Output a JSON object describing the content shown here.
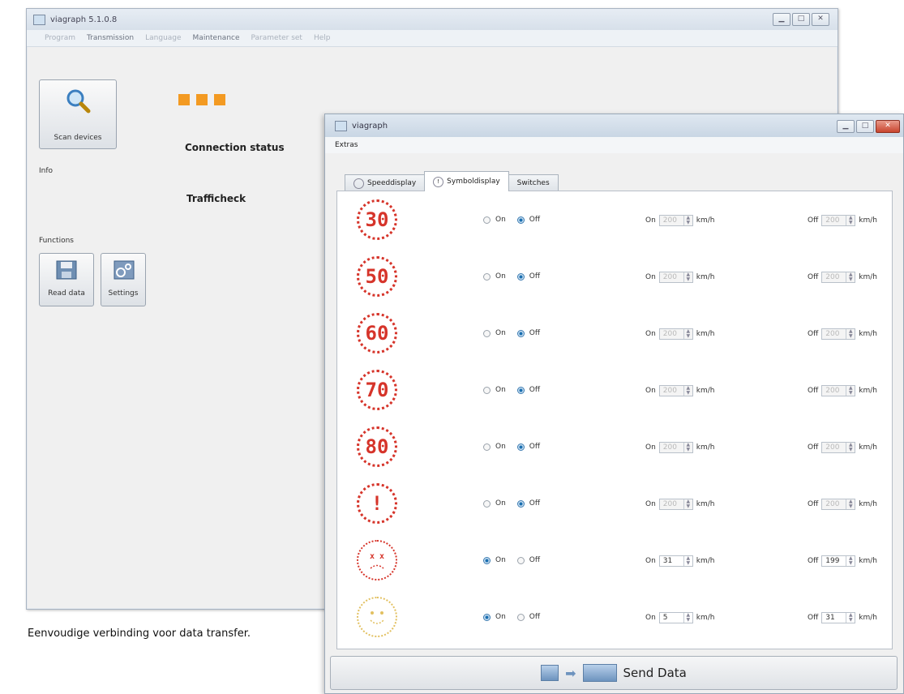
{
  "back_window": {
    "title": "viagraph 5.1.0.8",
    "menu": [
      "Program",
      "Transmission",
      "Language",
      "Maintenance",
      "Parameter set",
      "Help"
    ],
    "scan_label": "Scan devices",
    "connection_status_label": "Connection status",
    "info_label": "Info",
    "device_name": "Trafficheck",
    "functions_label": "Functions",
    "read_data_label": "Read data",
    "settings_label": "Settings",
    "led_color": "#f39a22"
  },
  "caption": "Eenvoudige verbinding voor data transfer.",
  "front_window": {
    "title": "viagraph",
    "menu_extras": "Extras",
    "tabs": [
      "Speeddisplay",
      "Symboldisplay",
      "Switches"
    ],
    "active_tab": "Symboldisplay",
    "on_label": "On",
    "off_label": "Off",
    "unit": "km/h",
    "rows": [
      {
        "symbol": "30",
        "on_selected": false,
        "on_value": "200",
        "off_value": "200",
        "enabled": false
      },
      {
        "symbol": "50",
        "on_selected": false,
        "on_value": "200",
        "off_value": "200",
        "enabled": false
      },
      {
        "symbol": "60",
        "on_selected": false,
        "on_value": "200",
        "off_value": "200",
        "enabled": false
      },
      {
        "symbol": "70",
        "on_selected": false,
        "on_value": "200",
        "off_value": "200",
        "enabled": false
      },
      {
        "symbol": "80",
        "on_selected": false,
        "on_value": "200",
        "off_value": "200",
        "enabled": false
      },
      {
        "symbol": "!",
        "on_selected": false,
        "on_value": "200",
        "off_value": "200",
        "enabled": false
      },
      {
        "symbol": "sad-face-icon",
        "on_selected": true,
        "on_value": "31",
        "off_value": "199",
        "enabled": true
      },
      {
        "symbol": "happy-face-icon",
        "on_selected": true,
        "on_value": "5",
        "off_value": "31",
        "enabled": true
      }
    ],
    "send_label": "Send Data"
  }
}
